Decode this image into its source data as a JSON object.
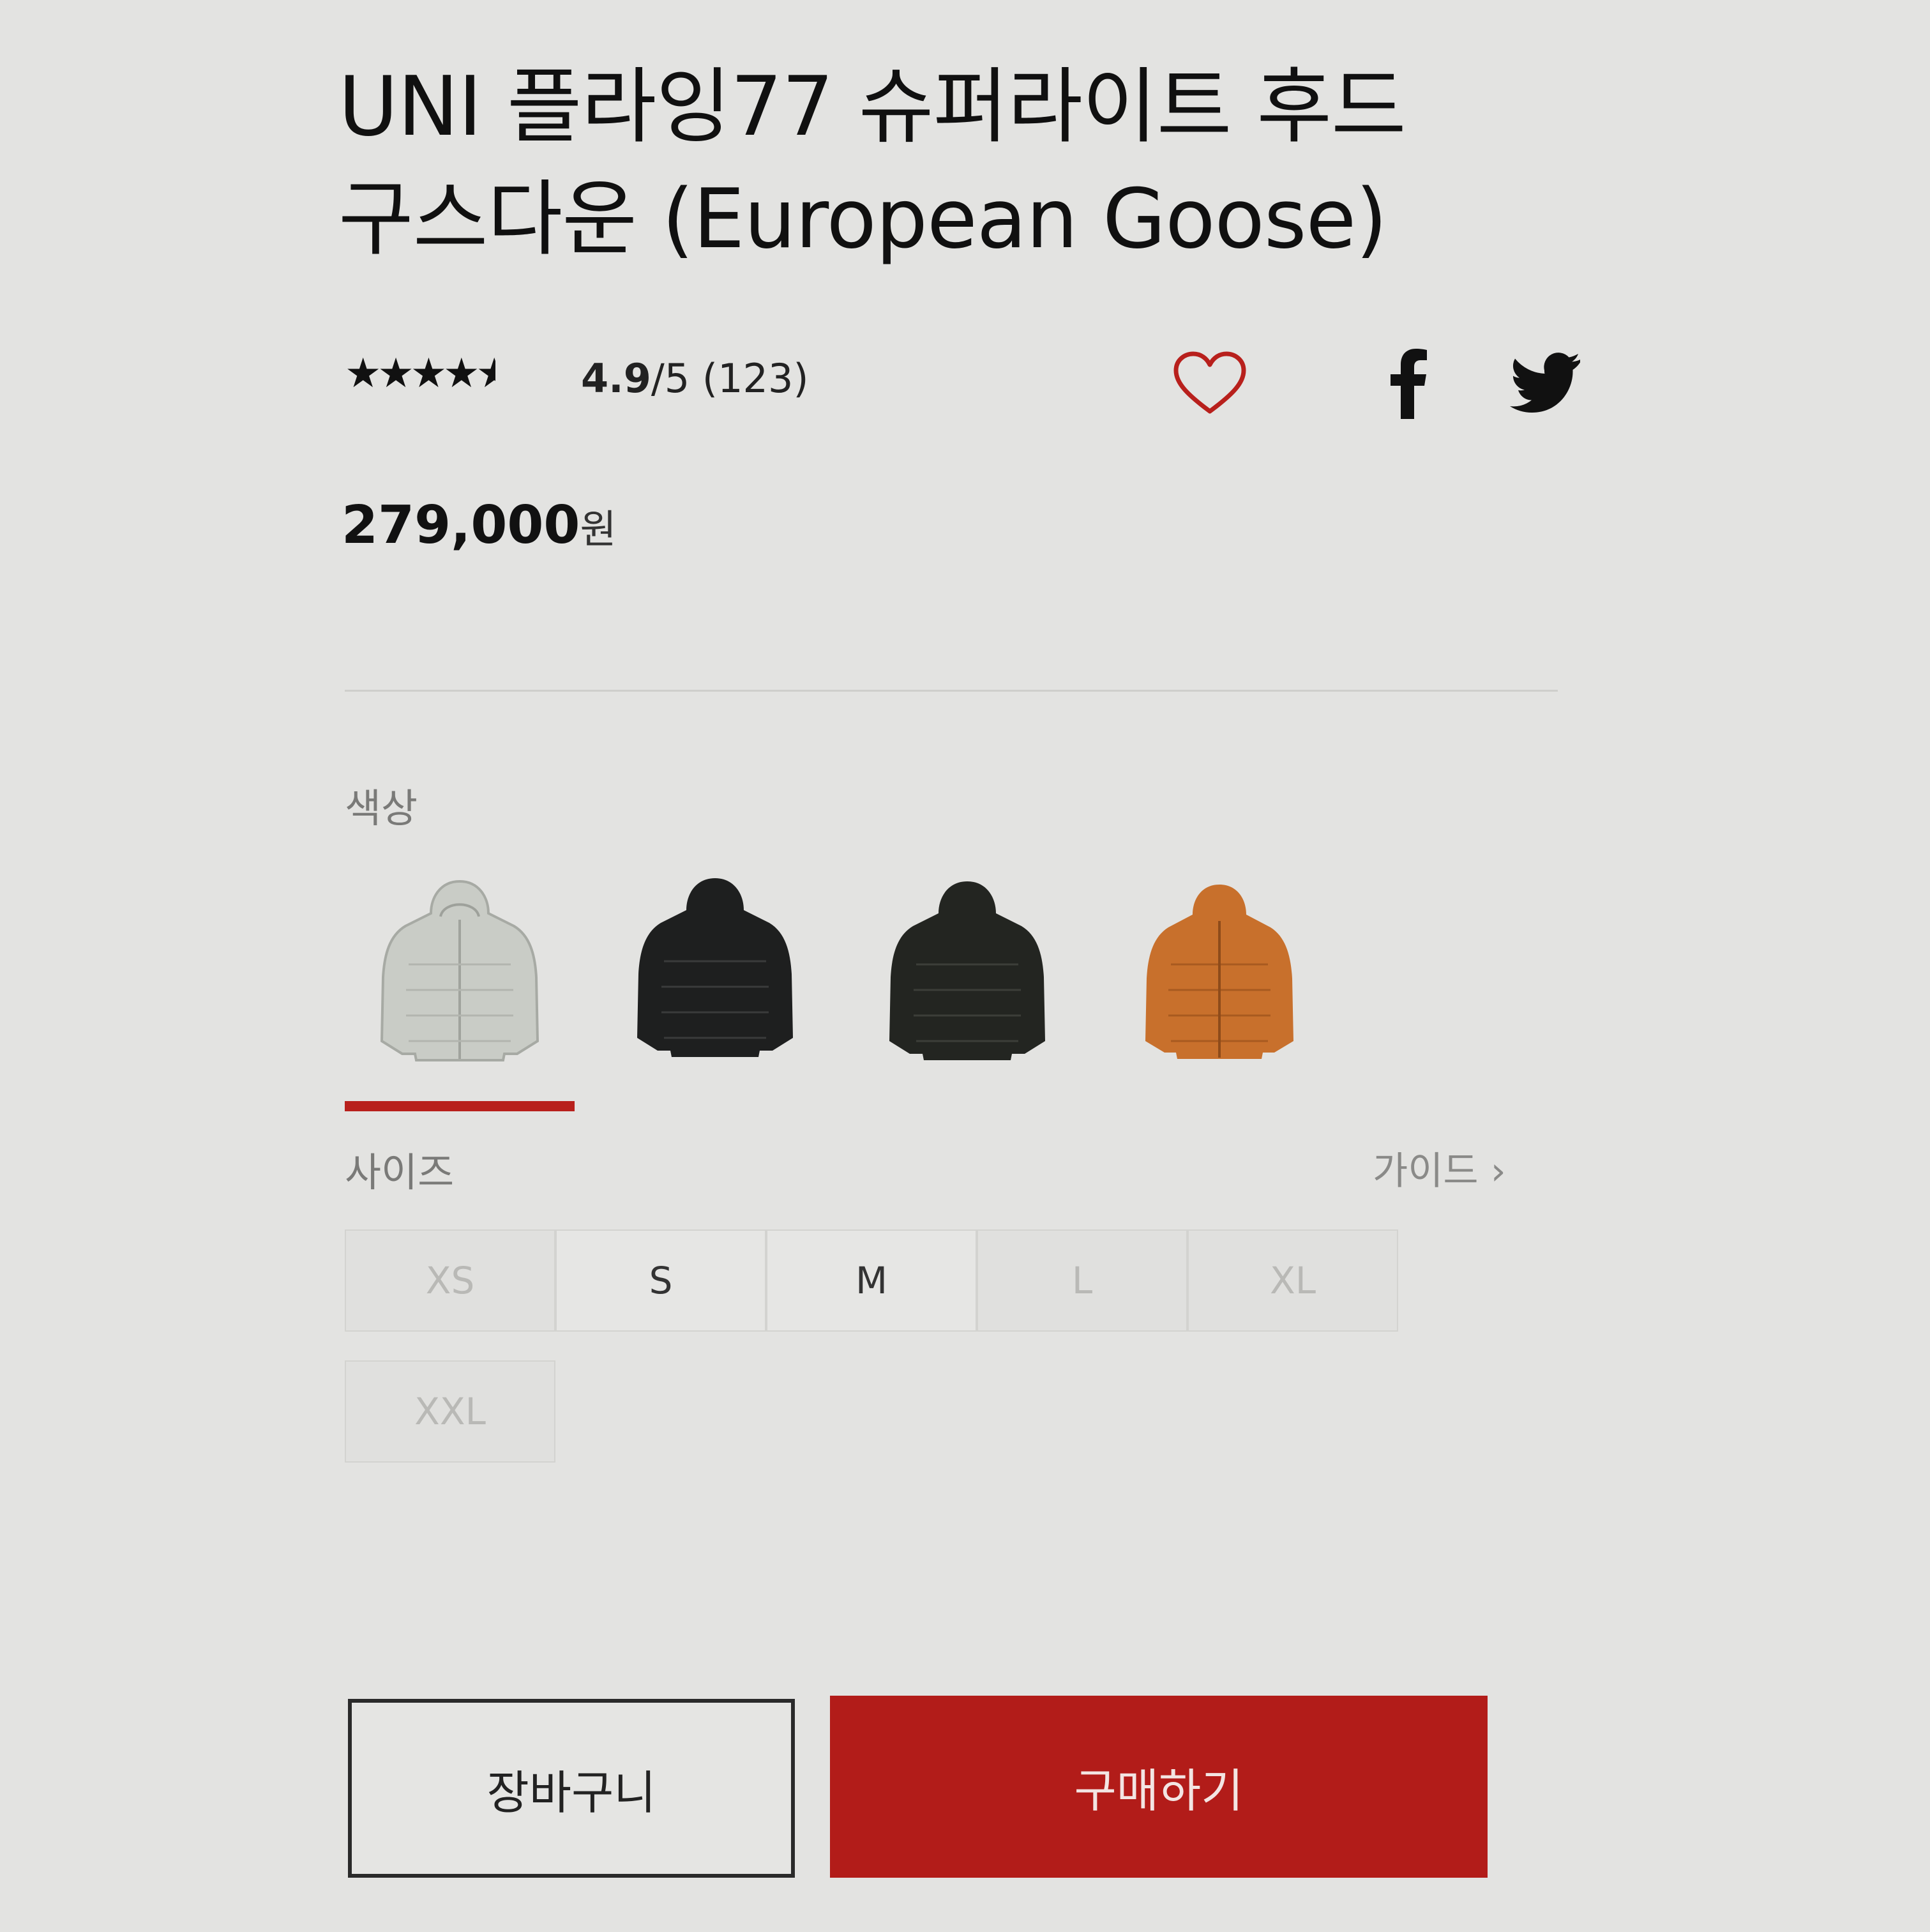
{
  "product": {
    "title_line1": "UNI 플라잉77 슈퍼라이트 후드",
    "title_line2": "구스다운 (European Goose)",
    "stars": 4.5,
    "rating_value": "4.9",
    "rating_max": "/5",
    "review_count": "(123)",
    "price": "279,000",
    "price_unit": "원"
  },
  "icons": {
    "wishlist": "heart-icon",
    "facebook": "facebook-icon",
    "twitter": "twitter-icon",
    "guide_arrow": "chevron-right-icon"
  },
  "color_section": {
    "label": "색상",
    "swatches": [
      {
        "name": "light-gray",
        "color": "#c9ccc6",
        "selected": true
      },
      {
        "name": "black",
        "color": "#1e1f1f",
        "selected": false
      },
      {
        "name": "dark-olive",
        "color": "#232521",
        "selected": false
      },
      {
        "name": "orange",
        "color": "#c8702c",
        "selected": false
      }
    ],
    "selected_color": "#b8201c"
  },
  "size_section": {
    "label": "사이즈",
    "guide_label": "가이드",
    "guide_arrow": "›",
    "sizes": [
      {
        "label": "XS",
        "available": false
      },
      {
        "label": "S",
        "available": true
      },
      {
        "label": "M",
        "available": true
      },
      {
        "label": "L",
        "available": false
      },
      {
        "label": "XL",
        "available": false
      },
      {
        "label": "XXL",
        "available": false
      }
    ]
  },
  "actions": {
    "cart_label": "장바구니",
    "buy_label": "구매하기",
    "buy_color": "#b21c19"
  }
}
